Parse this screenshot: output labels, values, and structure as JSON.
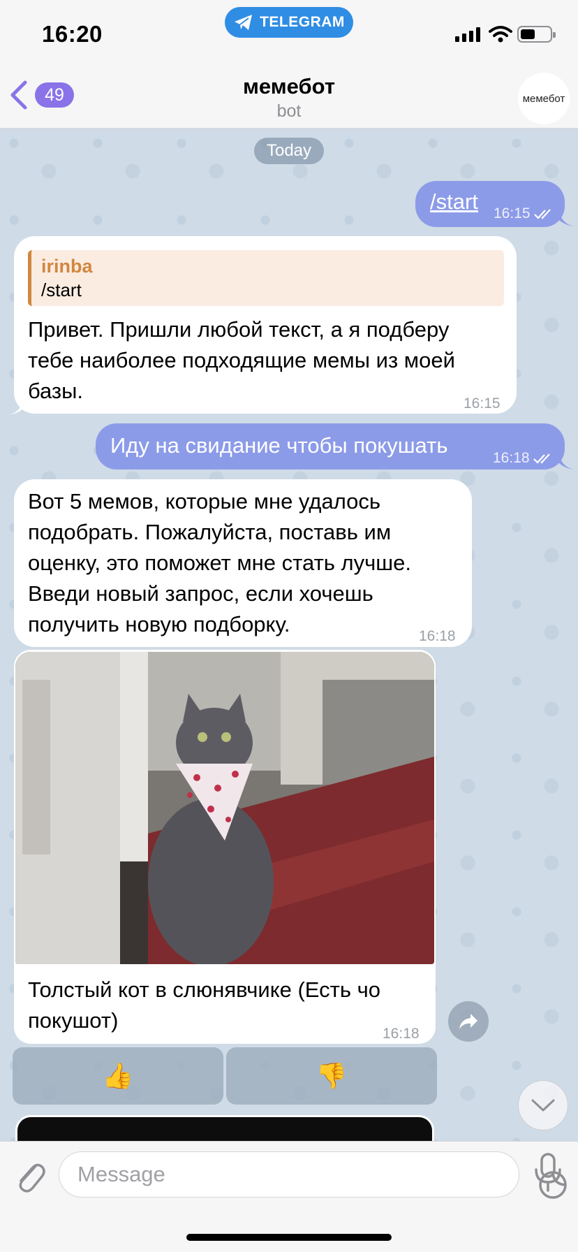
{
  "status_bar": {
    "time": "16:20",
    "pill_label": "TELEGRAM"
  },
  "header": {
    "back_count": "49",
    "title": "мемебот",
    "subtitle": "bot",
    "avatar_text": "мемебот"
  },
  "chat": {
    "date_divider": "Today",
    "messages": [
      {
        "dir": "out",
        "text": "/start",
        "time": "16:15"
      },
      {
        "dir": "in",
        "reply_author": "irinba",
        "reply_text": "/start",
        "lines": [
          "Привет. Пришли любой текст, а я подберу",
          "тебе наиболее подходящие мемы из моей",
          "базы."
        ],
        "time": "16:15"
      },
      {
        "dir": "out",
        "text": "Иду на свидание чтобы покушать",
        "time": "16:18"
      },
      {
        "dir": "in",
        "lines": [
          "Вот 5 мемов, которые мне удалось",
          "подобрать. Пожалуйста, поставь им",
          "оценку, это поможет мне стать лучше.",
          "Введи новый запрос, если хочешь",
          "получить новую подборку."
        ],
        "time": "16:18"
      },
      {
        "dir": "in",
        "type": "photo",
        "caption_lines": [
          "Толстый кот в слюнявчике (Есть чо",
          "покушот)"
        ],
        "time": "16:18"
      }
    ],
    "reactions": {
      "like": "👍",
      "dislike": "👎"
    }
  },
  "input": {
    "placeholder": "Message"
  },
  "icons": [
    "telegram-icon",
    "signal-icon",
    "wifi-icon",
    "battery-icon",
    "back-chevron-icon",
    "read-checks-icon",
    "share-icon",
    "chevron-down-icon",
    "attach-icon",
    "sticker-icon",
    "mic-icon"
  ],
  "colors": {
    "accent": "#8a73e8",
    "outgoing_bubble": "#8c9be8",
    "reply_bar": "#d1873f",
    "chat_bg": "#cfdbe6",
    "telegram_pill": "#2f8de4"
  }
}
